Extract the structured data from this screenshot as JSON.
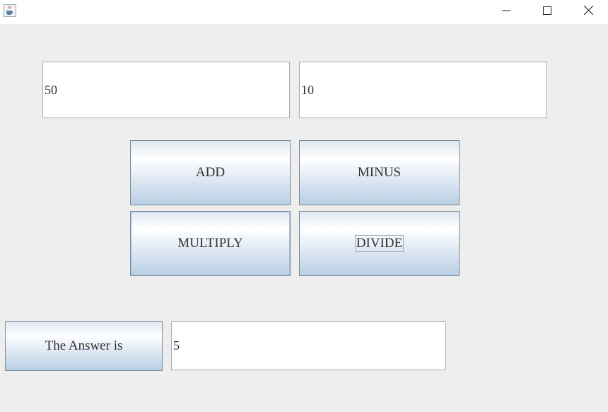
{
  "titlebar": {
    "icons": {
      "app": "java-cup-icon",
      "minimize": "minimize-icon",
      "maximize": "maximize-icon",
      "close": "close-icon"
    }
  },
  "inputs": {
    "first_value": "50",
    "second_value": "10",
    "answer_value": "5"
  },
  "buttons": {
    "add": "ADD",
    "minus": "MINUS",
    "multiply": "MULTIPLY",
    "divide": "DIVIDE",
    "answer": "The Answer is"
  },
  "colors": {
    "background": "#eeeeee",
    "button_gradient_bottom": "#b9cfe4",
    "field_border": "#a7abb2"
  }
}
